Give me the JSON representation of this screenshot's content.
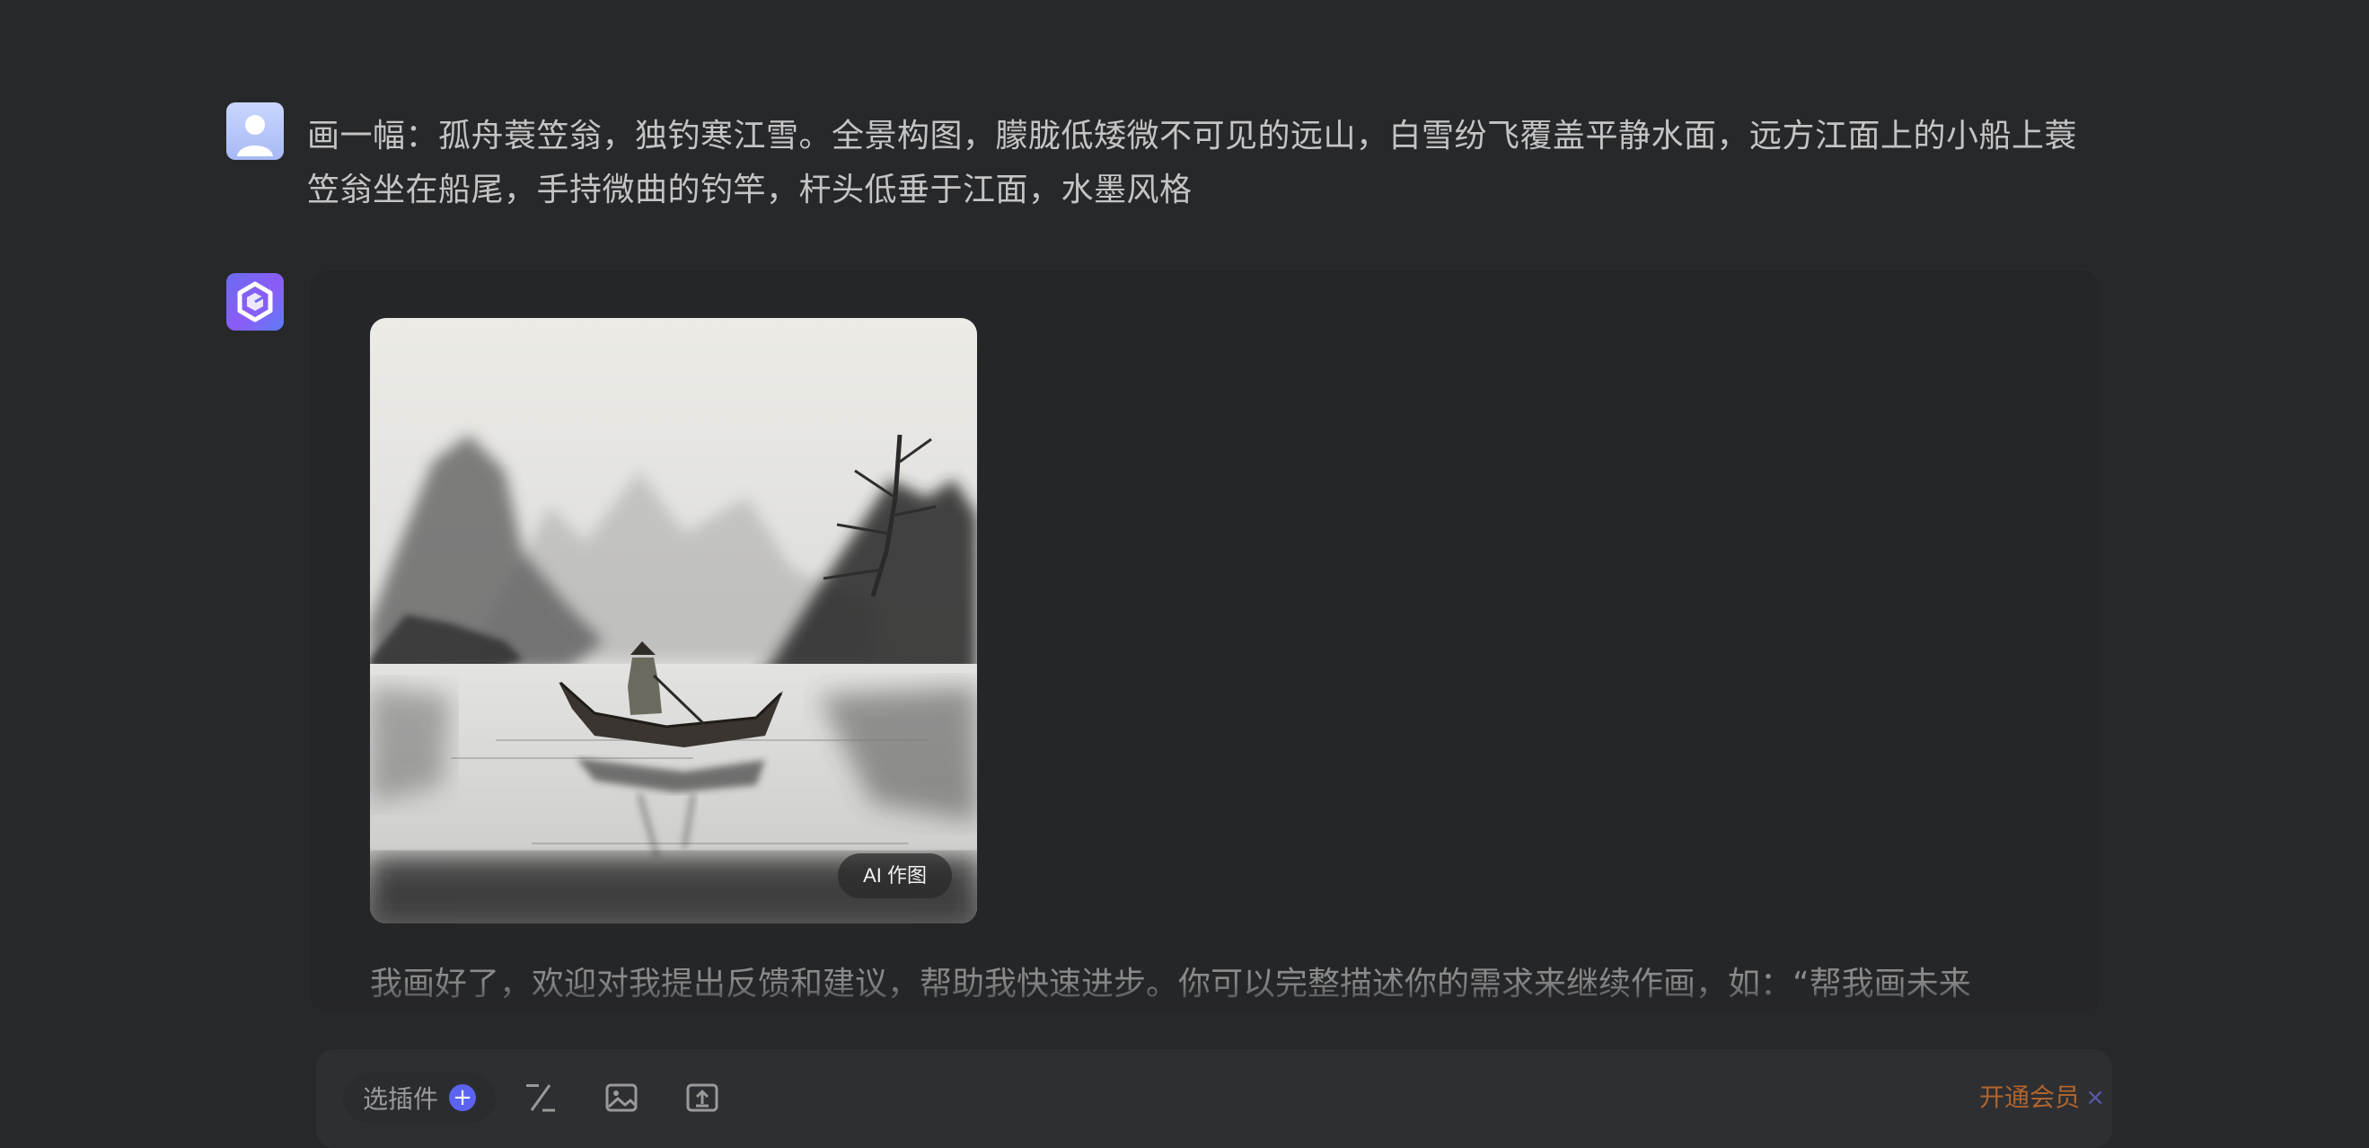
{
  "conversation": {
    "user_message": "画一幅：孤舟蓑笠翁，独钓寒江雪。全景构图，朦胧低矮微不可见的远山，白雪纷飞覆盖平静水面，远方江面上的小船上蓑笠翁坐在船尾，手持微曲的钓竿，杆头低垂于江面，水墨风格",
    "image_badge": "AI 作图",
    "bot_reply": "我画好了，欢迎对我提出反馈和建议，帮助我快速进步。你可以完整描述你的需求来继续作画，如：“帮我画未来"
  },
  "composer": {
    "plugin_label": "选插件",
    "plugin_add": "+",
    "tools": [
      "slash-command-icon",
      "image-icon",
      "upload-icon"
    ],
    "vip_label": "开通会员",
    "vip_close": "×"
  },
  "colors": {
    "background": "#27282a",
    "accent": "#5b63f0",
    "vip": "#b0652e"
  }
}
